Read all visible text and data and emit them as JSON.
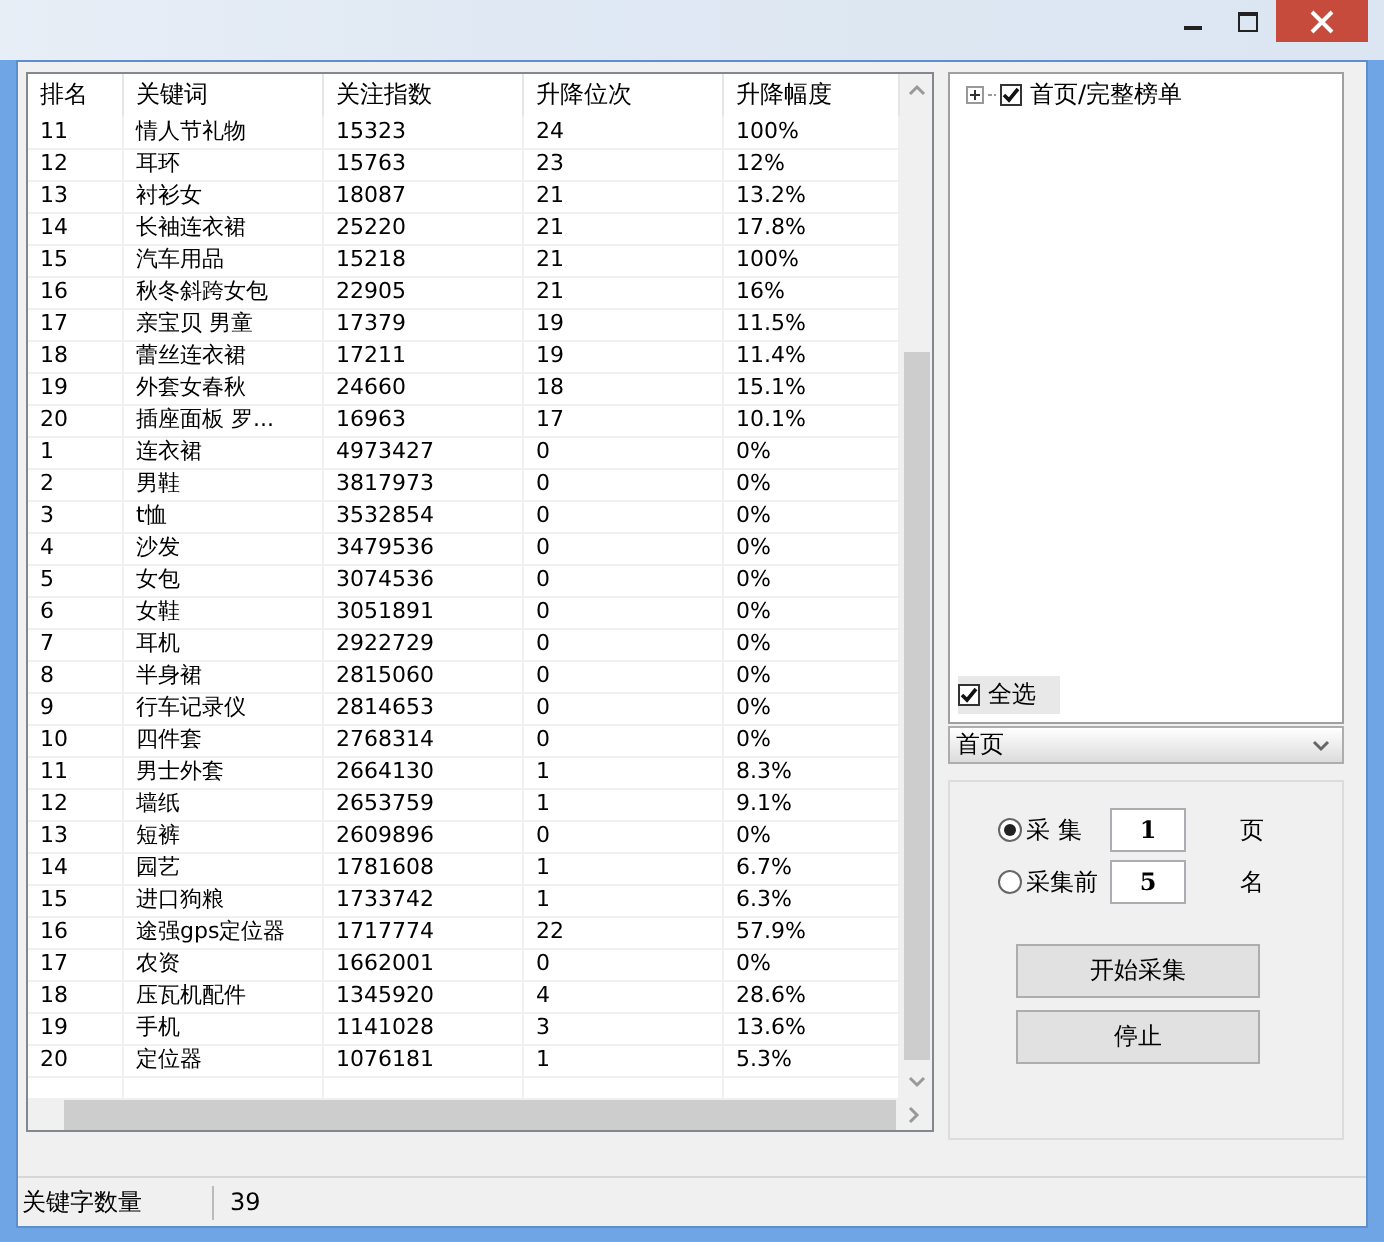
{
  "table": {
    "columns": [
      "排名",
      "关键词",
      "关注指数",
      "升降位次",
      "升降幅度"
    ],
    "rows": [
      [
        "11",
        "情人节礼物",
        "15323",
        "24",
        "100%"
      ],
      [
        "12",
        "耳环",
        "15763",
        "23",
        "12%"
      ],
      [
        "13",
        "衬衫女",
        "18087",
        "21",
        "13.2%"
      ],
      [
        "14",
        "长袖连衣裙",
        "25220",
        "21",
        "17.8%"
      ],
      [
        "15",
        "汽车用品",
        "15218",
        "21",
        "100%"
      ],
      [
        "16",
        "秋冬斜跨女包",
        "22905",
        "21",
        "16%"
      ],
      [
        "17",
        "亲宝贝 男童",
        "17379",
        "19",
        "11.5%"
      ],
      [
        "18",
        "蕾丝连衣裙",
        "17211",
        "19",
        "11.4%"
      ],
      [
        "19",
        "外套女春秋",
        "24660",
        "18",
        "15.1%"
      ],
      [
        "20",
        "插座面板 罗...",
        "16963",
        "17",
        "10.1%"
      ],
      [
        "1",
        "连衣裙",
        "4973427",
        "0",
        "0%"
      ],
      [
        "2",
        "男鞋",
        "3817973",
        "0",
        "0%"
      ],
      [
        "3",
        "t恤",
        "3532854",
        "0",
        "0%"
      ],
      [
        "4",
        "沙发",
        "3479536",
        "0",
        "0%"
      ],
      [
        "5",
        "女包",
        "3074536",
        "0",
        "0%"
      ],
      [
        "6",
        "女鞋",
        "3051891",
        "0",
        "0%"
      ],
      [
        "7",
        "耳机",
        "2922729",
        "0",
        "0%"
      ],
      [
        "8",
        "半身裙",
        "2815060",
        "0",
        "0%"
      ],
      [
        "9",
        "行车记录仪",
        "2814653",
        "0",
        "0%"
      ],
      [
        "10",
        "四件套",
        "2768314",
        "0",
        "0%"
      ],
      [
        "11",
        "男士外套",
        "2664130",
        "1",
        "8.3%"
      ],
      [
        "12",
        "墙纸",
        "2653759",
        "1",
        "9.1%"
      ],
      [
        "13",
        "短裤",
        "2609896",
        "0",
        "0%"
      ],
      [
        "14",
        "园艺",
        "1781608",
        "1",
        "6.7%"
      ],
      [
        "15",
        "进口狗粮",
        "1733742",
        "1",
        "6.3%"
      ],
      [
        "16",
        "途强gps定位器",
        "1717774",
        "22",
        "57.9%"
      ],
      [
        "17",
        "农资",
        "1662001",
        "0",
        "0%"
      ],
      [
        "18",
        "压瓦机配件",
        "1345920",
        "4",
        "28.6%"
      ],
      [
        "19",
        "手机",
        "1141028",
        "3",
        "13.6%"
      ],
      [
        "20",
        "定位器",
        "1076181",
        "1",
        "5.3%"
      ]
    ]
  },
  "tree": {
    "items": [
      {
        "label": "首页/完整榜单",
        "checked": true,
        "expanded": false
      }
    ]
  },
  "select_all": {
    "label": "全选",
    "checked": true
  },
  "category_dropdown": {
    "value": "首页"
  },
  "collect_options": [
    {
      "label": "采 集",
      "selected": true,
      "value": "1",
      "unit": "页"
    },
    {
      "label": "采集前",
      "selected": false,
      "value": "5",
      "unit": "名"
    }
  ],
  "buttons": [
    "开始采集",
    "停止"
  ],
  "status_bar": {
    "label": "关键字数量",
    "count": "39"
  }
}
